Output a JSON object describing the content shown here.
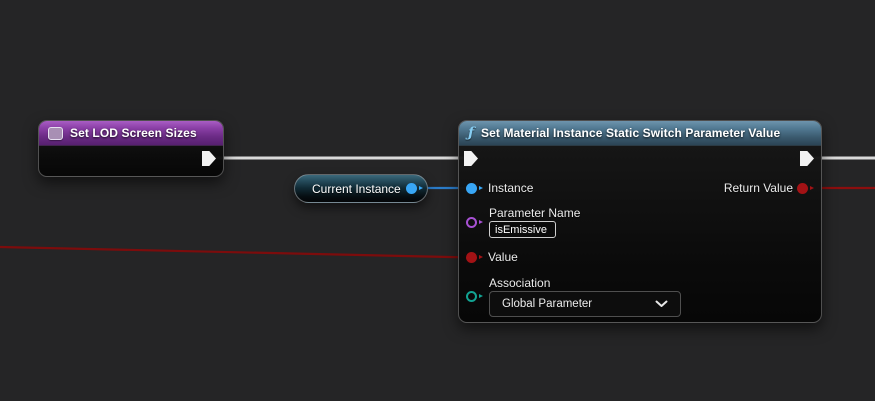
{
  "canvas": {
    "background": "#252526"
  },
  "palette": {
    "exec_pin": "#f2f2f2",
    "exec_wire": "#d9d9d9",
    "pin_blue": "#38a6f5",
    "wire_blue": "#2b7cc9",
    "pin_purple": "#a751d3",
    "pin_red": "#a31215",
    "wire_red": "#7c0c0c",
    "pin_teal": "#12a392",
    "header_function": "#527a93",
    "header_purple": "#8a3fa6"
  },
  "icons": {
    "function_glyph": "ƒ",
    "set_variable": "square-badge",
    "chevron_down": "chevron-down"
  },
  "nodes": {
    "set_lod": {
      "title": "Set LOD Screen Sizes"
    },
    "current_instance": {
      "label": "Current Instance"
    },
    "set_material_switch": {
      "title": "Set Material Instance Static Switch Parameter Value",
      "inputs": [
        {
          "label": "Instance"
        },
        {
          "label": "Parameter Name",
          "value": "isEmissive"
        },
        {
          "label": "Value"
        },
        {
          "label": "Association",
          "value": "Global Parameter"
        }
      ],
      "outputs": [
        {
          "label": "Return Value"
        }
      ]
    }
  }
}
